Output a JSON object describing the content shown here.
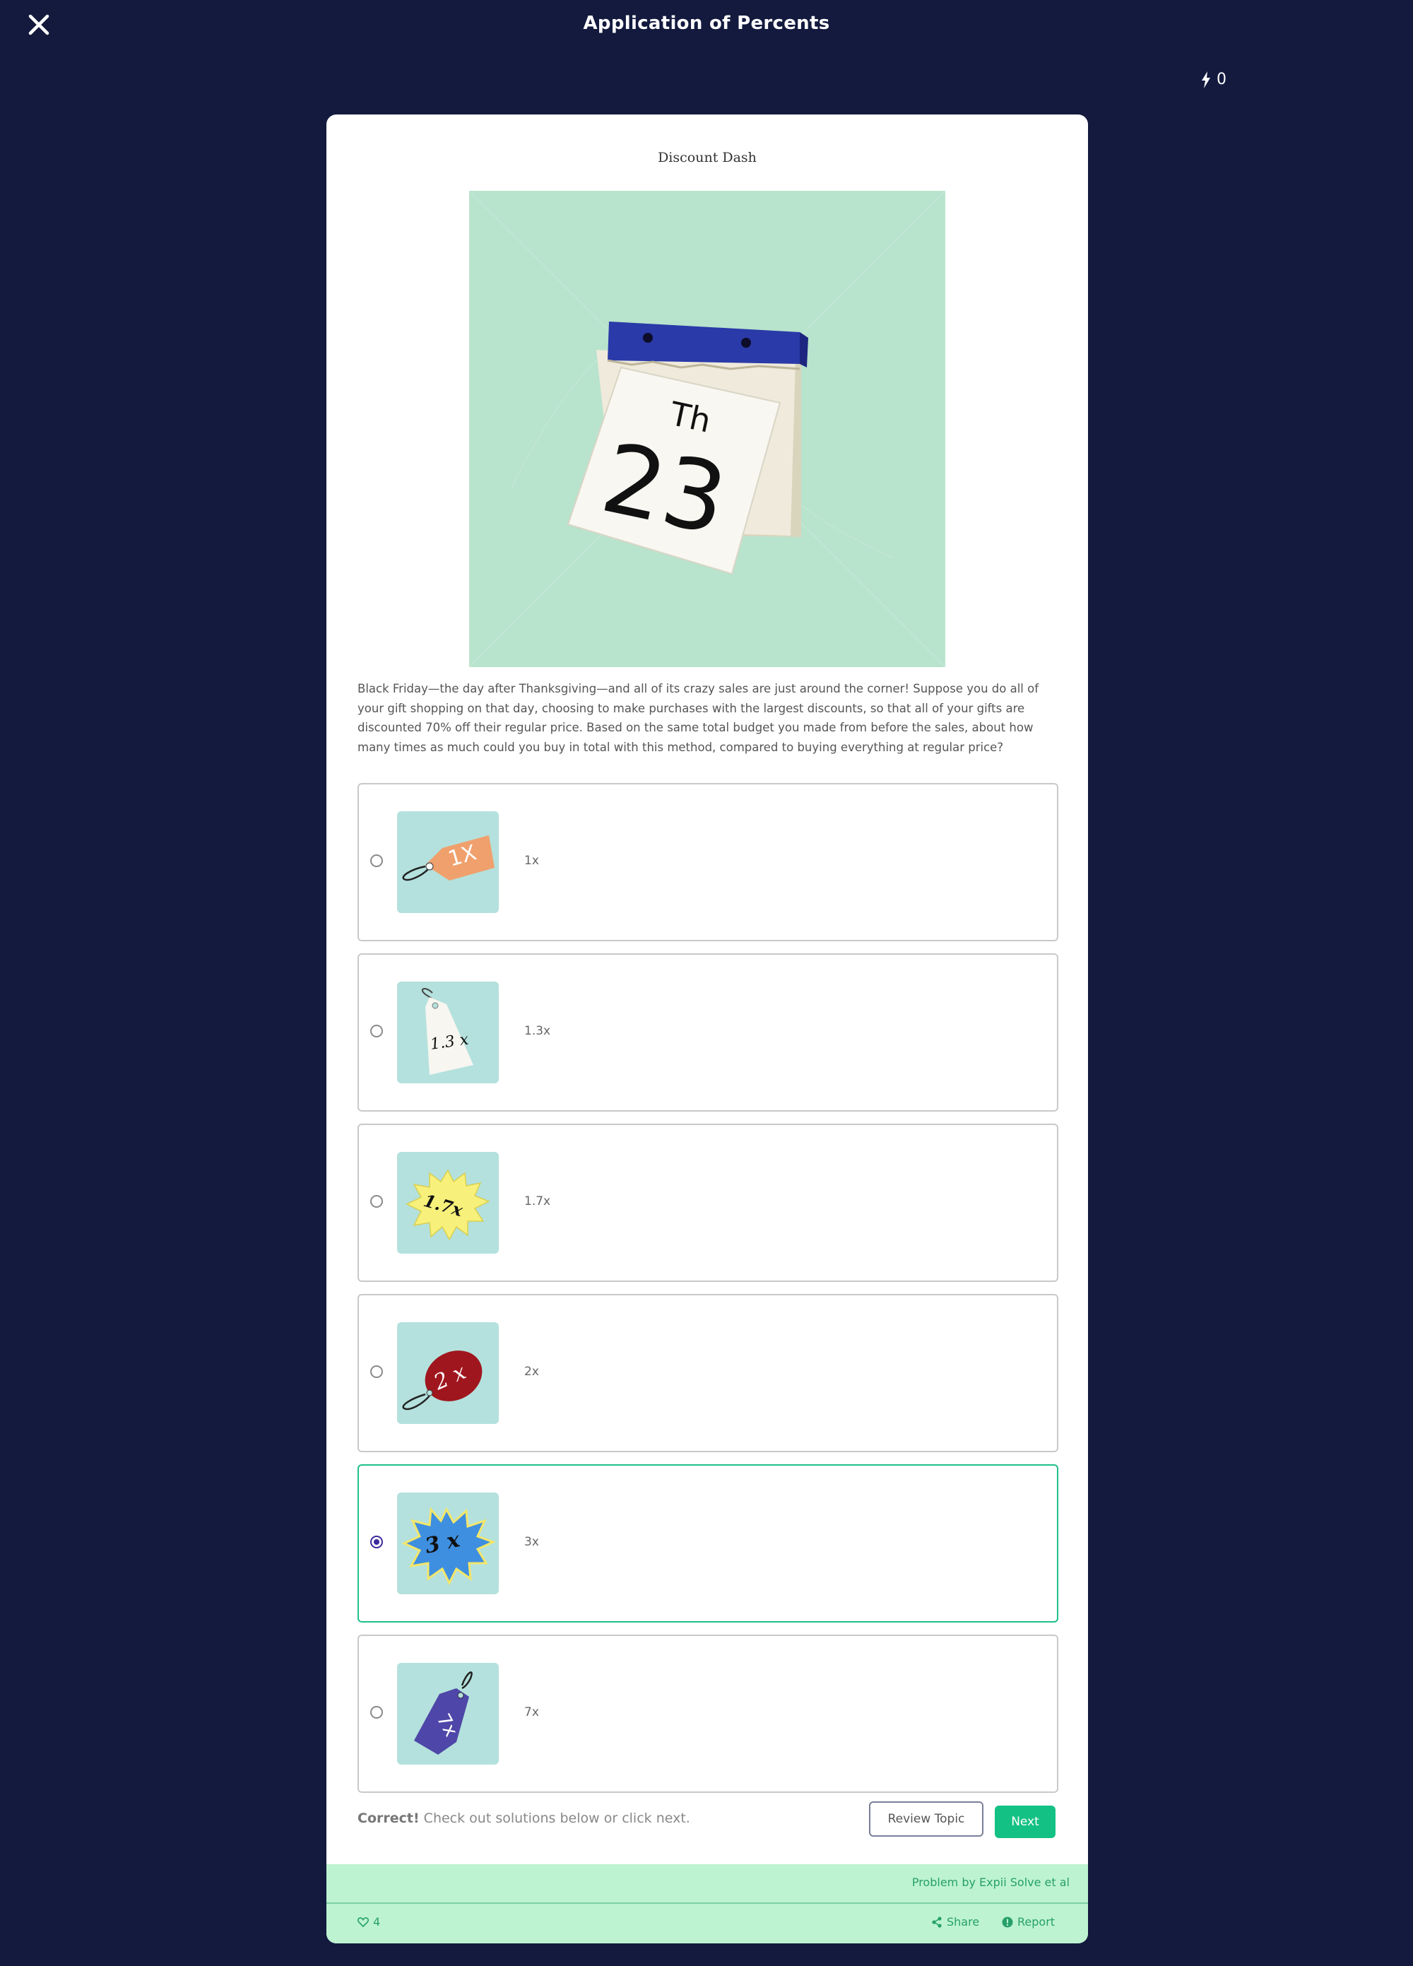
{
  "header": {
    "title": "Application of Percents",
    "energy_count": "0",
    "close_icon": "close-icon",
    "energy_icon": "lightning-bolt-icon"
  },
  "problem": {
    "title": "Discount Dash",
    "calendar_day_label": "Th",
    "calendar_date": "23",
    "question": "Black Friday—the day after Thanksgiving—and all of its crazy sales are just around the corner! Suppose you do all of your gift shopping on that day, choosing to make purchases with the largest discounts, so that all of your gifts are discounted 70% off their regular price. Based on the same total budget you made from before the sales, about how many times as much could you buy in total with this method, compared to buying everything at regular price?"
  },
  "options": [
    {
      "label": "1x",
      "tag_text": "1X",
      "selected": false
    },
    {
      "label": "1.3x",
      "tag_text": "1.3 x",
      "selected": false
    },
    {
      "label": "1.7x",
      "tag_text": "1.7x",
      "selected": false
    },
    {
      "label": "2x",
      "tag_text": "2 x",
      "selected": false
    },
    {
      "label": "3x",
      "tag_text": "3 x",
      "selected": true
    },
    {
      "label": "7x",
      "tag_text": "7x",
      "selected": false
    }
  ],
  "feedback": {
    "strong": "Correct!",
    "text": " Check out solutions below or click next."
  },
  "buttons": {
    "review": "Review Topic",
    "next": "Next"
  },
  "footer": {
    "author": "Problem by Expii Solve et al",
    "likes": "4",
    "share": "Share",
    "report": "Report"
  },
  "colors": {
    "background": "#131a3e",
    "accent": "#14c184",
    "footer": "#bdf3d1",
    "selected_border": "#1fc08a"
  }
}
